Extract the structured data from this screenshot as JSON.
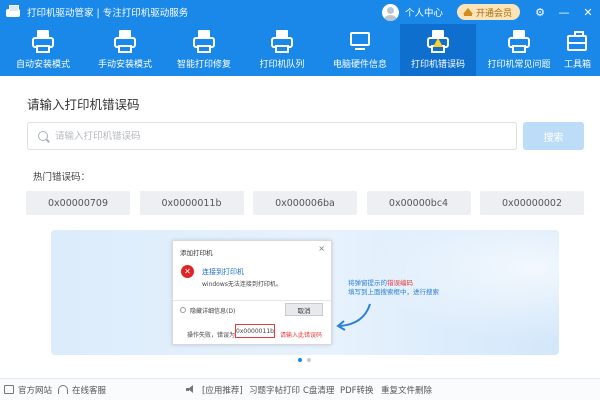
{
  "titlebar": {
    "app_title": "打印机驱动管家 | 专注打印机驱动服务",
    "user_center": "个人中心",
    "vip_button": "开通会员",
    "gear_icon": "⚙",
    "minimize_icon": "—",
    "close_icon": "✕"
  },
  "nav": [
    {
      "label": "自动安装模式",
      "icon": "printer-icon"
    },
    {
      "label": "手动安装模式",
      "icon": "printer-hand-icon"
    },
    {
      "label": "智能打印修复",
      "icon": "printer-ai-icon"
    },
    {
      "label": "打印机队列",
      "icon": "printer-queue-icon"
    },
    {
      "label": "电脑硬件信息",
      "icon": "monitor-icon"
    },
    {
      "label": "打印机错误码",
      "icon": "printer-warning-icon",
      "active": true
    },
    {
      "label": "打印机常见问题",
      "icon": "printer-question-icon"
    },
    {
      "label": "工具箱",
      "icon": "toolbox-icon"
    }
  ],
  "main": {
    "title": "请输入打印机错误码",
    "search_placeholder": "请输入打印机错误码",
    "search_button": "搜索",
    "hot_label": "热门错误码：",
    "hot_codes": [
      "0x00000709",
      "0x0000011b",
      "0x000006ba",
      "0x00000bc4",
      "0x00000002"
    ]
  },
  "banner": {
    "dialog": {
      "title": "添加打印机",
      "close": "×",
      "heading": "连接到打印机",
      "message": "windows无法连接到打印机。",
      "detail": "隐藏详细信息(D)",
      "cancel": "取消",
      "fail_text": "操作失败，错误为",
      "code": "0x0000011b",
      "hint": "请输入此错误码"
    },
    "tip_prefix": "将弹窗提示的",
    "tip_highlight": "错误编码",
    "tip_line2": "填写到上面搜索框中，进行搜索"
  },
  "footer": {
    "website": "官方网站",
    "support": "在线客服",
    "recommend": "[应用推荐]",
    "links": [
      "习题字帖打印",
      "C盘清理",
      "PDF转换",
      "重复文件删除"
    ]
  },
  "colors": {
    "primary": "#1a88e8",
    "active_tab": "#0f6fcf",
    "error_red": "#e53b3b",
    "warning_yellow": "#ffd02a"
  }
}
